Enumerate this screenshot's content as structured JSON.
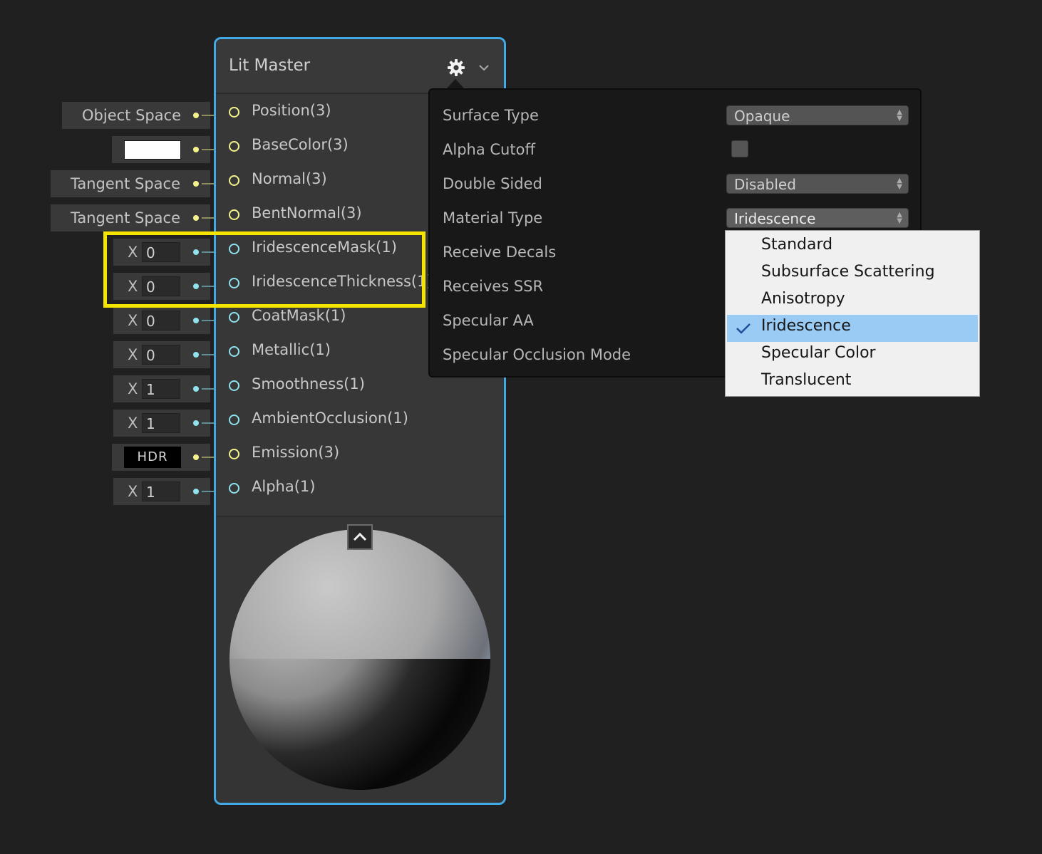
{
  "node": {
    "title": "Lit Master",
    "slots": [
      {
        "name": "Position(3)",
        "type": "vector"
      },
      {
        "name": "BaseColor(3)",
        "type": "vector"
      },
      {
        "name": "Normal(3)",
        "type": "vector"
      },
      {
        "name": "BentNormal(3)",
        "type": "vector"
      },
      {
        "name": "IridescenceMask(1)",
        "type": "scalar"
      },
      {
        "name": "IridescenceThickness(1)",
        "type": "scalar"
      },
      {
        "name": "CoatMask(1)",
        "type": "scalar"
      },
      {
        "name": "Metallic(1)",
        "type": "scalar"
      },
      {
        "name": "Smoothness(1)",
        "type": "scalar"
      },
      {
        "name": "AmbientOcclusion(1)",
        "type": "scalar"
      },
      {
        "name": "Emission(3)",
        "type": "vector"
      },
      {
        "name": "Alpha(1)",
        "type": "scalar"
      }
    ]
  },
  "inputs": [
    {
      "kind": "label",
      "text": "Object Space"
    },
    {
      "kind": "color",
      "value": "#ffffff"
    },
    {
      "kind": "label",
      "text": "Tangent Space"
    },
    {
      "kind": "label",
      "text": "Tangent Space"
    },
    {
      "kind": "float",
      "axis": "X",
      "value": "0"
    },
    {
      "kind": "float",
      "axis": "X",
      "value": "0"
    },
    {
      "kind": "float",
      "axis": "X",
      "value": "0"
    },
    {
      "kind": "float",
      "axis": "X",
      "value": "0"
    },
    {
      "kind": "float",
      "axis": "X",
      "value": "1"
    },
    {
      "kind": "float",
      "axis": "X",
      "value": "1"
    },
    {
      "kind": "hdr",
      "text": "HDR"
    },
    {
      "kind": "float",
      "axis": "X",
      "value": "1"
    }
  ],
  "settings": {
    "rows": [
      {
        "label": "Surface Type",
        "control": "dropdown",
        "value": "Opaque"
      },
      {
        "label": "Alpha Cutoff",
        "control": "checkbox",
        "checked": false
      },
      {
        "label": "Double Sided",
        "control": "dropdown",
        "value": "Disabled"
      },
      {
        "label": "Material Type",
        "control": "dropdown",
        "value": "Iridescence"
      },
      {
        "label": "Receive Decals"
      },
      {
        "label": "Receives SSR"
      },
      {
        "label": "Specular AA"
      },
      {
        "label": "Specular Occlusion Mode"
      }
    ]
  },
  "material_menu": {
    "options": [
      "Standard",
      "Subsurface Scattering",
      "Anisotropy",
      "Iridescence",
      "Specular Color",
      "Translucent"
    ],
    "selected": "Iridescence"
  },
  "colors": {
    "node_border": "#42a8e6",
    "highlight": "#f5e400",
    "vector_port": "#f4f28c",
    "scalar_port": "#8ee3ef",
    "menu_selected": "#99cbf4"
  }
}
